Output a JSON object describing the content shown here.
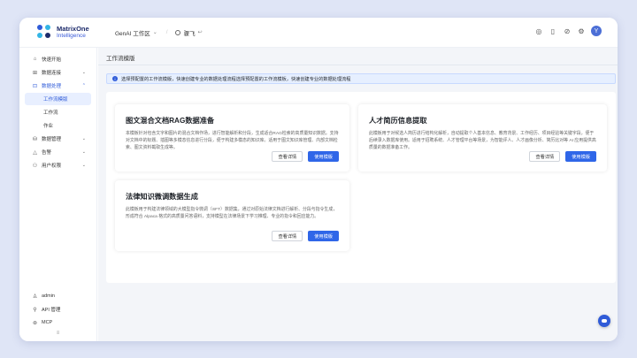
{
  "brand": {
    "name_line1": "MatrixOne",
    "name_line2": "Intelligence",
    "colors": [
      "#2f5bd8",
      "#33b5e5",
      "#1d2b6b"
    ]
  },
  "header": {
    "workspace_label": "GenAI 工作区",
    "user_label": "骤飞",
    "avatar_initial": "Y",
    "icons": [
      "headset-icon",
      "book-icon",
      "share-icon",
      "gear-icon"
    ]
  },
  "sidebar": {
    "items": [
      {
        "label": "快速开始",
        "icon": "rocket-icon",
        "caret": ""
      },
      {
        "label": "数据连接",
        "icon": "link-icon",
        "caret": "⌄"
      },
      {
        "label": "数据处理",
        "icon": "process-icon",
        "caret": "⌃",
        "active": true
      },
      {
        "label": "工作流模版",
        "sub": true,
        "selected": true
      },
      {
        "label": "工作流",
        "sub": true
      },
      {
        "label": "作业",
        "sub": true
      },
      {
        "label": "数据管理",
        "icon": "database-icon",
        "caret": "⌄"
      },
      {
        "label": "告警",
        "icon": "bell-icon",
        "caret": "⌄"
      },
      {
        "label": "用户权限",
        "icon": "users-icon",
        "caret": "⌄"
      }
    ],
    "bottom_items": [
      {
        "label": "admin",
        "icon": "user-icon"
      },
      {
        "label": "API 管理",
        "icon": "api-icon"
      },
      {
        "label": "MCP",
        "icon": "mcp-icon"
      }
    ],
    "collapse_symbol": "≡"
  },
  "main": {
    "page_title": "工作流模版",
    "info_text": "选择预配置的工作流模版，快速创建专业的数据处理流程选择预配置的工作流模板，快速创建专业的数据处理流程",
    "detail_label": "查看详情",
    "use_label": "使用模版",
    "cards": [
      {
        "title": "图文混合文档RAG数据准备",
        "description": "本模板针对包含文字和图片的混合文档作场，进行智能解析和分段，生成适合RAG检索的高质量知识数据。支持对文档中的标题、插图等多模态信息进行分段，便于构建多模态的知识库。适用于图文知识库管理、内部文档检索、图文资料截取生成等。"
      },
      {
        "title": "人才简历信息提取",
        "description": "此模板用于对候选人简历进行结构化解析，自动提取个人基本信息、教育背景、工作经历、项目经验等关键字段，便于后续录入数据库使用。适用于招聘系统、人才管理平台等场景，为智能评人、人才画像分析、简历比对等 AI 应用提供高质量的数据准备工作。"
      },
      {
        "title": "法律知识微调数据生成",
        "description": "此模板用于构建法律领域的大模型指令微调（SFT）数据集，通过对原始法律文档进行解析、分段与指令生成，形成符合 Alpaca 格式的高质量问答语料，支持模型在法律场景下学习推理、专业的指令和回应能力。"
      }
    ]
  }
}
